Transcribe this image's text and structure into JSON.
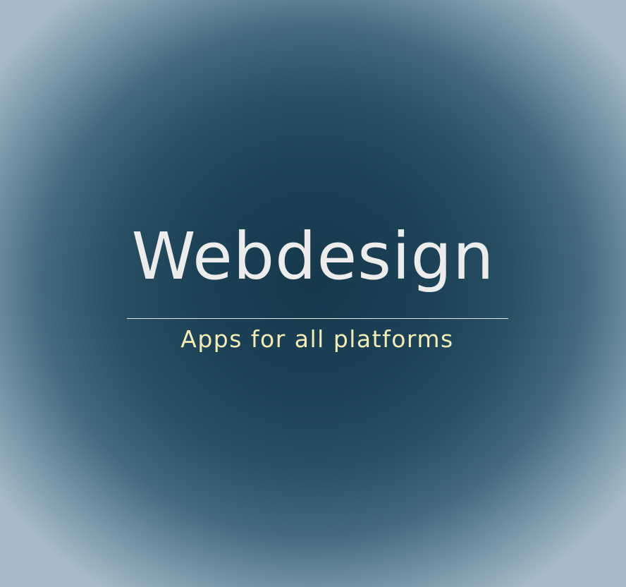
{
  "logo": {
    "title": "Webdesign",
    "tagline": "Apps for all platforms"
  },
  "colors": {
    "background_center": "#17384b",
    "background_edge": "#a6bac7",
    "title": "#ececec",
    "tagline": "#f2ecb6",
    "divider": "#e6e6e6"
  }
}
